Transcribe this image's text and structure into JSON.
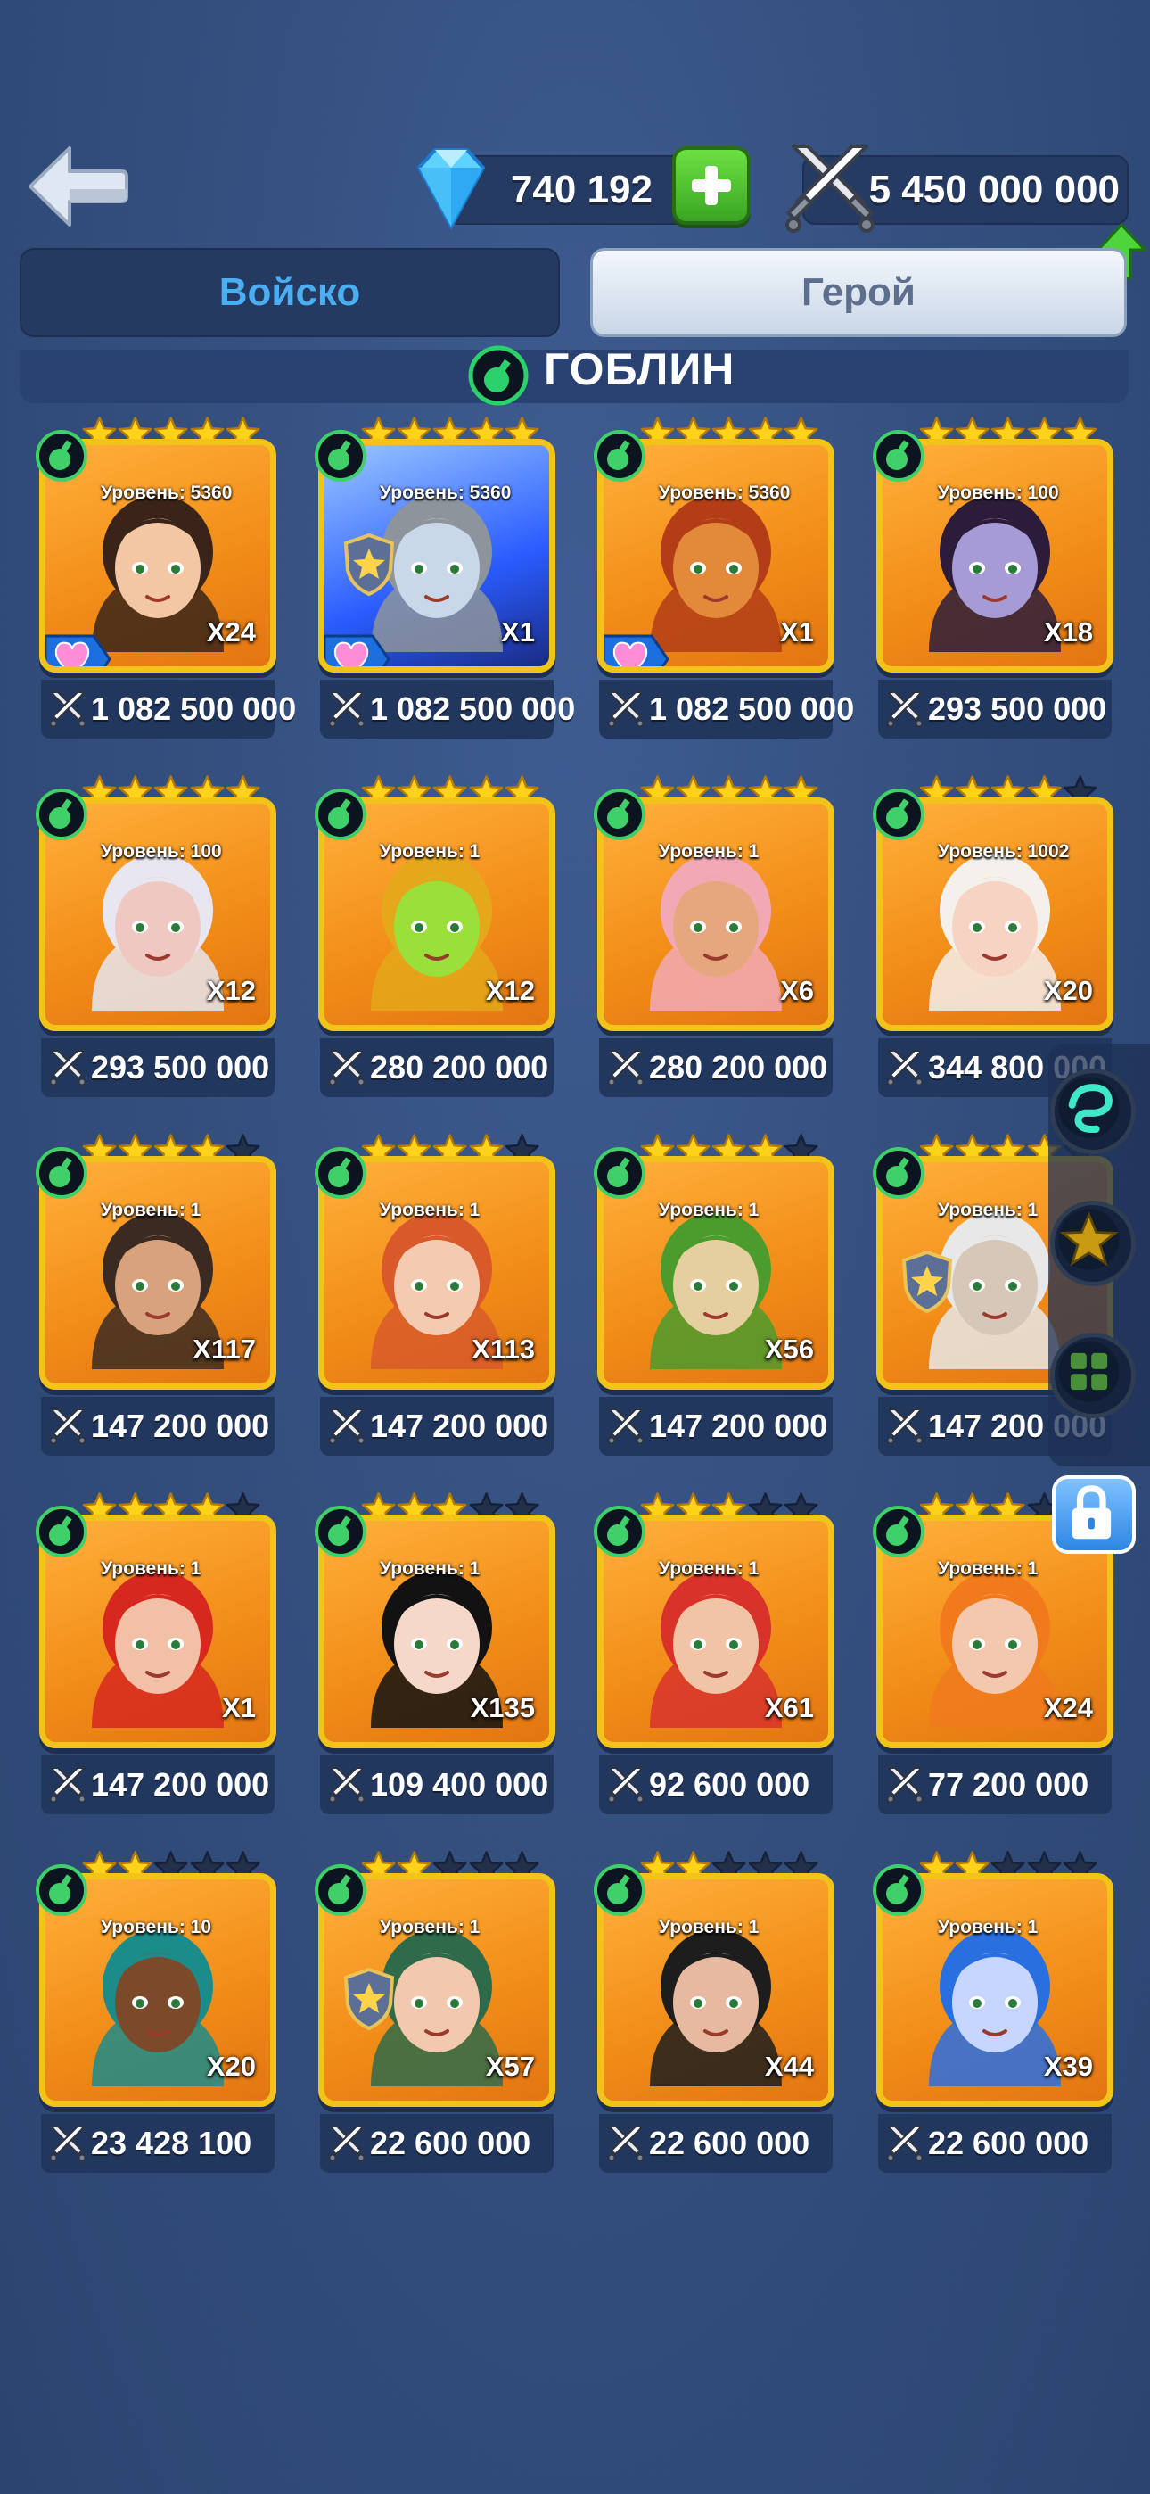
{
  "topbar": {
    "gems": "740 192",
    "power": "5 450 000 000"
  },
  "tabs": {
    "army": "Войско",
    "hero": "Герой"
  },
  "section": {
    "title": "ГОБЛИН"
  },
  "colors": {
    "accent_blue": "#4aaef0",
    "card_border": "#f2c318",
    "star_gold": "#ffd319",
    "class_green": "#3fd06a"
  },
  "heroes": [
    {
      "level": "Уровень: 5360",
      "count": "X24",
      "power": "1 082 500 000",
      "stars": 5,
      "badge": "heart",
      "face": "#f3c6a4",
      "hair": "#3a2419"
    },
    {
      "level": "Уровень: 5360",
      "count": "X1",
      "power": "1 082 500 000",
      "stars": 5,
      "badge": "heart",
      "face": "#c9d8e8",
      "hair": "#8d949c",
      "special": true,
      "shield": true
    },
    {
      "level": "Уровень: 5360",
      "count": "X1",
      "power": "1 082 500 000",
      "stars": 5,
      "badge": "heart",
      "face": "#e28a3a",
      "hair": "#b23d16"
    },
    {
      "level": "Уровень: 100",
      "count": "X18",
      "power": "293 500 000",
      "stars": 5,
      "face": "#a79bd6",
      "hair": "#2c1c3a"
    },
    {
      "level": "Уровень: 100",
      "count": "X12",
      "power": "293 500 000",
      "stars": 5,
      "face": "#f0c8c2",
      "hair": "#e8e6f0"
    },
    {
      "level": "Уровень: 1",
      "count": "X12",
      "power": "280 200 000",
      "stars": 5,
      "face": "#9be03a",
      "hair": "#e4a81a"
    },
    {
      "level": "Уровень: 1",
      "count": "X6",
      "power": "280 200 000",
      "stars": 5,
      "face": "#e6a77e",
      "hair": "#f2a9b5"
    },
    {
      "level": "Уровень: 1002",
      "count": "X20",
      "power": "344 800 000",
      "stars": 4,
      "face": "#f6d3c2",
      "hair": "#f4f0ec"
    },
    {
      "level": "Уровень: 1",
      "count": "X117",
      "power": "147 200 000",
      "stars": 4,
      "face": "#d8a27c",
      "hair": "#3b2a22"
    },
    {
      "level": "Уровень: 1",
      "count": "X113",
      "power": "147 200 000",
      "stars": 4,
      "face": "#f4cbb0",
      "hair": "#d85a2a"
    },
    {
      "level": "Уровень: 1",
      "count": "X56",
      "power": "147 200 000",
      "stars": 4,
      "face": "#e6cf9f",
      "hair": "#4c9b2d"
    },
    {
      "level": "Уровень: 1",
      "count": "X",
      "power": "147 200 000",
      "stars": 4,
      "face": "#d6c7b8",
      "hair": "#e8e8e8",
      "shield": true
    },
    {
      "level": "Уровень: 1",
      "count": "X1",
      "power": "147 200 000",
      "stars": 4,
      "face": "#f2c0a6",
      "hair": "#d6281e"
    },
    {
      "level": "Уровень: 1",
      "count": "X135",
      "power": "109 400 000",
      "stars": 3,
      "face": "#f6d8c8",
      "hair": "#121212"
    },
    {
      "level": "Уровень: 1",
      "count": "X61",
      "power": "92 600 000",
      "stars": 3,
      "face": "#f2c4a6",
      "hair": "#d8322a"
    },
    {
      "level": "Уровень: 1",
      "count": "X24",
      "power": "77 200 000",
      "stars": 3,
      "face": "#f4c8ae",
      "hair": "#f07a1c"
    },
    {
      "level": "Уровень: 10",
      "count": "X20",
      "power": "23 428 100",
      "stars": 2,
      "face": "#7a4a2a",
      "hair": "#1c8c8a"
    },
    {
      "level": "Уровень: 1",
      "count": "X57",
      "power": "22 600 000",
      "stars": 2,
      "face": "#f2c9ae",
      "hair": "#2f6b4a",
      "shield": true
    },
    {
      "level": "Уровень: 1",
      "count": "X44",
      "power": "22 600 000",
      "stars": 2,
      "face": "#e6b9a0",
      "hair": "#1d1d1d"
    },
    {
      "level": "Уровень: 1",
      "count": "X39",
      "power": "22 600 000",
      "stars": 2,
      "face": "#c6d6ff",
      "hair": "#2a6fe0"
    }
  ]
}
